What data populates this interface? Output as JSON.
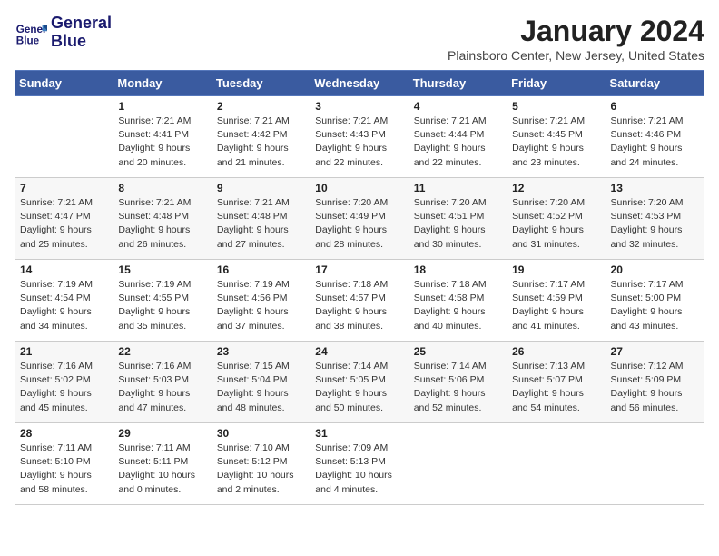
{
  "logo": {
    "line1": "General",
    "line2": "Blue"
  },
  "title": "January 2024",
  "location": "Plainsboro Center, New Jersey, United States",
  "days_of_week": [
    "Sunday",
    "Monday",
    "Tuesday",
    "Wednesday",
    "Thursday",
    "Friday",
    "Saturday"
  ],
  "weeks": [
    [
      {
        "day": "",
        "info": ""
      },
      {
        "day": "1",
        "info": "Sunrise: 7:21 AM\nSunset: 4:41 PM\nDaylight: 9 hours\nand 20 minutes."
      },
      {
        "day": "2",
        "info": "Sunrise: 7:21 AM\nSunset: 4:42 PM\nDaylight: 9 hours\nand 21 minutes."
      },
      {
        "day": "3",
        "info": "Sunrise: 7:21 AM\nSunset: 4:43 PM\nDaylight: 9 hours\nand 22 minutes."
      },
      {
        "day": "4",
        "info": "Sunrise: 7:21 AM\nSunset: 4:44 PM\nDaylight: 9 hours\nand 22 minutes."
      },
      {
        "day": "5",
        "info": "Sunrise: 7:21 AM\nSunset: 4:45 PM\nDaylight: 9 hours\nand 23 minutes."
      },
      {
        "day": "6",
        "info": "Sunrise: 7:21 AM\nSunset: 4:46 PM\nDaylight: 9 hours\nand 24 minutes."
      }
    ],
    [
      {
        "day": "7",
        "info": "Sunrise: 7:21 AM\nSunset: 4:47 PM\nDaylight: 9 hours\nand 25 minutes."
      },
      {
        "day": "8",
        "info": "Sunrise: 7:21 AM\nSunset: 4:48 PM\nDaylight: 9 hours\nand 26 minutes."
      },
      {
        "day": "9",
        "info": "Sunrise: 7:21 AM\nSunset: 4:48 PM\nDaylight: 9 hours\nand 27 minutes."
      },
      {
        "day": "10",
        "info": "Sunrise: 7:20 AM\nSunset: 4:49 PM\nDaylight: 9 hours\nand 28 minutes."
      },
      {
        "day": "11",
        "info": "Sunrise: 7:20 AM\nSunset: 4:51 PM\nDaylight: 9 hours\nand 30 minutes."
      },
      {
        "day": "12",
        "info": "Sunrise: 7:20 AM\nSunset: 4:52 PM\nDaylight: 9 hours\nand 31 minutes."
      },
      {
        "day": "13",
        "info": "Sunrise: 7:20 AM\nSunset: 4:53 PM\nDaylight: 9 hours\nand 32 minutes."
      }
    ],
    [
      {
        "day": "14",
        "info": "Sunrise: 7:19 AM\nSunset: 4:54 PM\nDaylight: 9 hours\nand 34 minutes."
      },
      {
        "day": "15",
        "info": "Sunrise: 7:19 AM\nSunset: 4:55 PM\nDaylight: 9 hours\nand 35 minutes."
      },
      {
        "day": "16",
        "info": "Sunrise: 7:19 AM\nSunset: 4:56 PM\nDaylight: 9 hours\nand 37 minutes."
      },
      {
        "day": "17",
        "info": "Sunrise: 7:18 AM\nSunset: 4:57 PM\nDaylight: 9 hours\nand 38 minutes."
      },
      {
        "day": "18",
        "info": "Sunrise: 7:18 AM\nSunset: 4:58 PM\nDaylight: 9 hours\nand 40 minutes."
      },
      {
        "day": "19",
        "info": "Sunrise: 7:17 AM\nSunset: 4:59 PM\nDaylight: 9 hours\nand 41 minutes."
      },
      {
        "day": "20",
        "info": "Sunrise: 7:17 AM\nSunset: 5:00 PM\nDaylight: 9 hours\nand 43 minutes."
      }
    ],
    [
      {
        "day": "21",
        "info": "Sunrise: 7:16 AM\nSunset: 5:02 PM\nDaylight: 9 hours\nand 45 minutes."
      },
      {
        "day": "22",
        "info": "Sunrise: 7:16 AM\nSunset: 5:03 PM\nDaylight: 9 hours\nand 47 minutes."
      },
      {
        "day": "23",
        "info": "Sunrise: 7:15 AM\nSunset: 5:04 PM\nDaylight: 9 hours\nand 48 minutes."
      },
      {
        "day": "24",
        "info": "Sunrise: 7:14 AM\nSunset: 5:05 PM\nDaylight: 9 hours\nand 50 minutes."
      },
      {
        "day": "25",
        "info": "Sunrise: 7:14 AM\nSunset: 5:06 PM\nDaylight: 9 hours\nand 52 minutes."
      },
      {
        "day": "26",
        "info": "Sunrise: 7:13 AM\nSunset: 5:07 PM\nDaylight: 9 hours\nand 54 minutes."
      },
      {
        "day": "27",
        "info": "Sunrise: 7:12 AM\nSunset: 5:09 PM\nDaylight: 9 hours\nand 56 minutes."
      }
    ],
    [
      {
        "day": "28",
        "info": "Sunrise: 7:11 AM\nSunset: 5:10 PM\nDaylight: 9 hours\nand 58 minutes."
      },
      {
        "day": "29",
        "info": "Sunrise: 7:11 AM\nSunset: 5:11 PM\nDaylight: 10 hours\nand 0 minutes."
      },
      {
        "day": "30",
        "info": "Sunrise: 7:10 AM\nSunset: 5:12 PM\nDaylight: 10 hours\nand 2 minutes."
      },
      {
        "day": "31",
        "info": "Sunrise: 7:09 AM\nSunset: 5:13 PM\nDaylight: 10 hours\nand 4 minutes."
      },
      {
        "day": "",
        "info": ""
      },
      {
        "day": "",
        "info": ""
      },
      {
        "day": "",
        "info": ""
      }
    ]
  ]
}
